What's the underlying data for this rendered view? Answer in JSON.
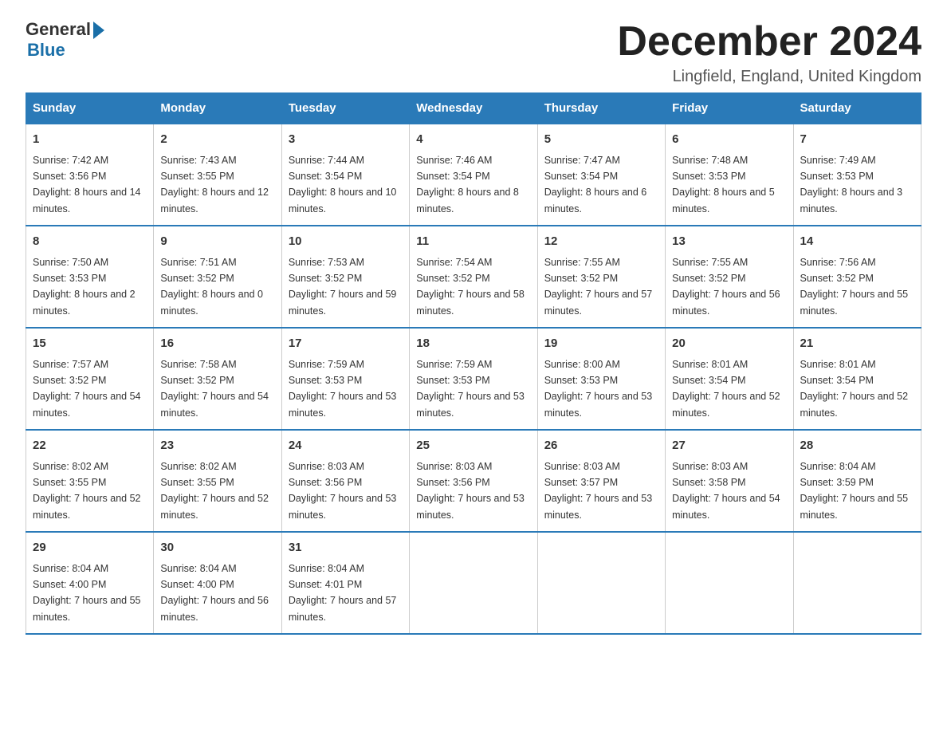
{
  "logo": {
    "general": "General",
    "blue": "Blue"
  },
  "title": "December 2024",
  "subtitle": "Lingfield, England, United Kingdom",
  "headers": [
    "Sunday",
    "Monday",
    "Tuesday",
    "Wednesday",
    "Thursday",
    "Friday",
    "Saturday"
  ],
  "weeks": [
    [
      {
        "day": "1",
        "sunrise": "7:42 AM",
        "sunset": "3:56 PM",
        "daylight": "8 hours and 14 minutes."
      },
      {
        "day": "2",
        "sunrise": "7:43 AM",
        "sunset": "3:55 PM",
        "daylight": "8 hours and 12 minutes."
      },
      {
        "day": "3",
        "sunrise": "7:44 AM",
        "sunset": "3:54 PM",
        "daylight": "8 hours and 10 minutes."
      },
      {
        "day": "4",
        "sunrise": "7:46 AM",
        "sunset": "3:54 PM",
        "daylight": "8 hours and 8 minutes."
      },
      {
        "day": "5",
        "sunrise": "7:47 AM",
        "sunset": "3:54 PM",
        "daylight": "8 hours and 6 minutes."
      },
      {
        "day": "6",
        "sunrise": "7:48 AM",
        "sunset": "3:53 PM",
        "daylight": "8 hours and 5 minutes."
      },
      {
        "day": "7",
        "sunrise": "7:49 AM",
        "sunset": "3:53 PM",
        "daylight": "8 hours and 3 minutes."
      }
    ],
    [
      {
        "day": "8",
        "sunrise": "7:50 AM",
        "sunset": "3:53 PM",
        "daylight": "8 hours and 2 minutes."
      },
      {
        "day": "9",
        "sunrise": "7:51 AM",
        "sunset": "3:52 PM",
        "daylight": "8 hours and 0 minutes."
      },
      {
        "day": "10",
        "sunrise": "7:53 AM",
        "sunset": "3:52 PM",
        "daylight": "7 hours and 59 minutes."
      },
      {
        "day": "11",
        "sunrise": "7:54 AM",
        "sunset": "3:52 PM",
        "daylight": "7 hours and 58 minutes."
      },
      {
        "day": "12",
        "sunrise": "7:55 AM",
        "sunset": "3:52 PM",
        "daylight": "7 hours and 57 minutes."
      },
      {
        "day": "13",
        "sunrise": "7:55 AM",
        "sunset": "3:52 PM",
        "daylight": "7 hours and 56 minutes."
      },
      {
        "day": "14",
        "sunrise": "7:56 AM",
        "sunset": "3:52 PM",
        "daylight": "7 hours and 55 minutes."
      }
    ],
    [
      {
        "day": "15",
        "sunrise": "7:57 AM",
        "sunset": "3:52 PM",
        "daylight": "7 hours and 54 minutes."
      },
      {
        "day": "16",
        "sunrise": "7:58 AM",
        "sunset": "3:52 PM",
        "daylight": "7 hours and 54 minutes."
      },
      {
        "day": "17",
        "sunrise": "7:59 AM",
        "sunset": "3:53 PM",
        "daylight": "7 hours and 53 minutes."
      },
      {
        "day": "18",
        "sunrise": "7:59 AM",
        "sunset": "3:53 PM",
        "daylight": "7 hours and 53 minutes."
      },
      {
        "day": "19",
        "sunrise": "8:00 AM",
        "sunset": "3:53 PM",
        "daylight": "7 hours and 53 minutes."
      },
      {
        "day": "20",
        "sunrise": "8:01 AM",
        "sunset": "3:54 PM",
        "daylight": "7 hours and 52 minutes."
      },
      {
        "day": "21",
        "sunrise": "8:01 AM",
        "sunset": "3:54 PM",
        "daylight": "7 hours and 52 minutes."
      }
    ],
    [
      {
        "day": "22",
        "sunrise": "8:02 AM",
        "sunset": "3:55 PM",
        "daylight": "7 hours and 52 minutes."
      },
      {
        "day": "23",
        "sunrise": "8:02 AM",
        "sunset": "3:55 PM",
        "daylight": "7 hours and 52 minutes."
      },
      {
        "day": "24",
        "sunrise": "8:03 AM",
        "sunset": "3:56 PM",
        "daylight": "7 hours and 53 minutes."
      },
      {
        "day": "25",
        "sunrise": "8:03 AM",
        "sunset": "3:56 PM",
        "daylight": "7 hours and 53 minutes."
      },
      {
        "day": "26",
        "sunrise": "8:03 AM",
        "sunset": "3:57 PM",
        "daylight": "7 hours and 53 minutes."
      },
      {
        "day": "27",
        "sunrise": "8:03 AM",
        "sunset": "3:58 PM",
        "daylight": "7 hours and 54 minutes."
      },
      {
        "day": "28",
        "sunrise": "8:04 AM",
        "sunset": "3:59 PM",
        "daylight": "7 hours and 55 minutes."
      }
    ],
    [
      {
        "day": "29",
        "sunrise": "8:04 AM",
        "sunset": "4:00 PM",
        "daylight": "7 hours and 55 minutes."
      },
      {
        "day": "30",
        "sunrise": "8:04 AM",
        "sunset": "4:00 PM",
        "daylight": "7 hours and 56 minutes."
      },
      {
        "day": "31",
        "sunrise": "8:04 AM",
        "sunset": "4:01 PM",
        "daylight": "7 hours and 57 minutes."
      },
      null,
      null,
      null,
      null
    ]
  ]
}
